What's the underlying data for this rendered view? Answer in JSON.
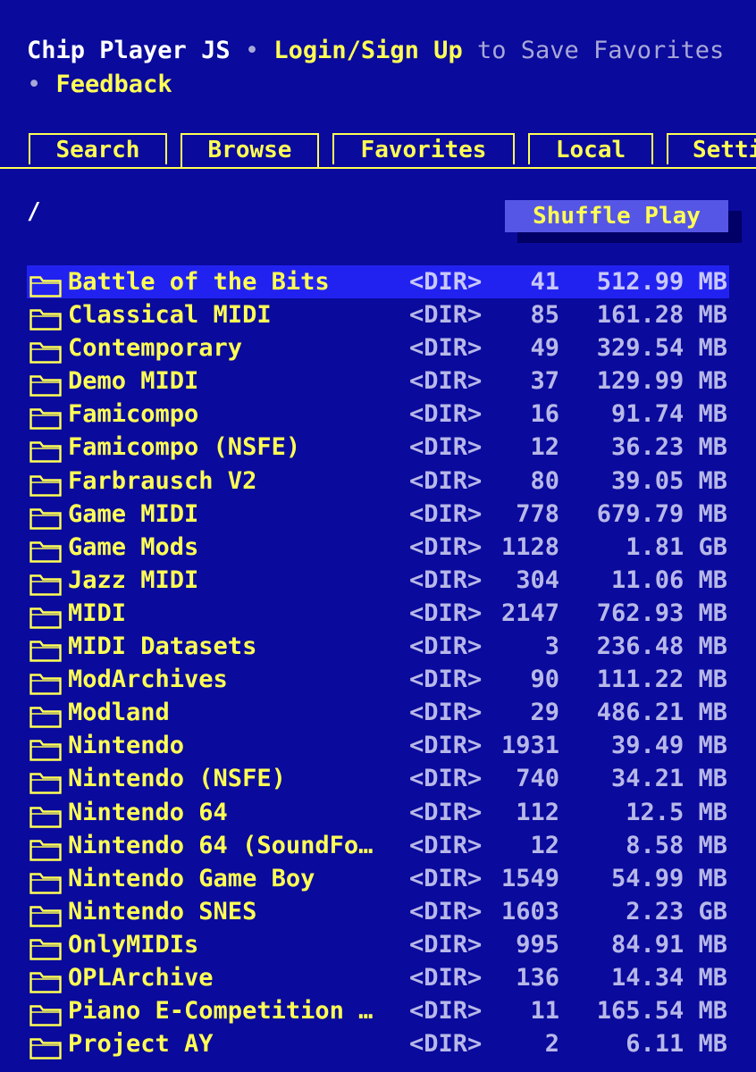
{
  "header": {
    "app_title": "Chip Player JS",
    "bullet": "•",
    "login_link": "Login/Sign Up",
    "save_text": "to Save Favorites",
    "feedback_link": "Feedback"
  },
  "tabs": [
    {
      "label": "Search",
      "active": false
    },
    {
      "label": "Browse",
      "active": true
    },
    {
      "label": "Favorites",
      "active": false
    },
    {
      "label": "Local",
      "active": false
    },
    {
      "label": "Settings",
      "active": false
    }
  ],
  "browse": {
    "path": "/",
    "shuffle_label": "Shuffle Play",
    "dir_tag": "<DIR>",
    "selected_index": 0,
    "rows": [
      {
        "name": "Battle of the Bits",
        "count": "41",
        "size": "512.99 MB"
      },
      {
        "name": "Classical MIDI",
        "count": "85",
        "size": "161.28 MB"
      },
      {
        "name": "Contemporary",
        "count": "49",
        "size": "329.54 MB"
      },
      {
        "name": "Demo MIDI",
        "count": "37",
        "size": "129.99 MB"
      },
      {
        "name": "Famicompo",
        "count": "16",
        "size": "91.74 MB"
      },
      {
        "name": "Famicompo (NSFE)",
        "count": "12",
        "size": "36.23 MB"
      },
      {
        "name": "Farbrausch V2",
        "count": "80",
        "size": "39.05 MB"
      },
      {
        "name": "Game MIDI",
        "count": "778",
        "size": "679.79 MB"
      },
      {
        "name": "Game Mods",
        "count": "1128",
        "size": "1.81 GB"
      },
      {
        "name": "Jazz MIDI",
        "count": "304",
        "size": "11.06 MB"
      },
      {
        "name": "MIDI",
        "count": "2147",
        "size": "762.93 MB"
      },
      {
        "name": "MIDI Datasets",
        "count": "3",
        "size": "236.48 MB"
      },
      {
        "name": "ModArchives",
        "count": "90",
        "size": "111.22 MB"
      },
      {
        "name": "Modland",
        "count": "29",
        "size": "486.21 MB"
      },
      {
        "name": "Nintendo",
        "count": "1931",
        "size": "39.49 MB"
      },
      {
        "name": "Nintendo (NSFE)",
        "count": "740",
        "size": "34.21 MB"
      },
      {
        "name": "Nintendo 64",
        "count": "112",
        "size": "12.5 MB"
      },
      {
        "name": "Nintendo 64 (SoundFon…",
        "count": "12",
        "size": "8.58 MB"
      },
      {
        "name": "Nintendo Game Boy",
        "count": "1549",
        "size": "54.99 MB"
      },
      {
        "name": "Nintendo SNES",
        "count": "1603",
        "size": "2.23 GB"
      },
      {
        "name": "OnlyMIDIs",
        "count": "995",
        "size": "84.91 MB"
      },
      {
        "name": "OPLArchive",
        "count": "136",
        "size": "14.34 MB"
      },
      {
        "name": "Piano E-Competition M…",
        "count": "11",
        "size": "165.54 MB"
      },
      {
        "name": "Project AY",
        "count": "2",
        "size": "6.11 MB"
      }
    ]
  },
  "colors": {
    "background": "#0a0a9c",
    "accent_yellow": "#ffff55",
    "selection": "#2222f0",
    "button": "#5656e6"
  },
  "icons": {
    "row_icon": "folder-icon"
  }
}
